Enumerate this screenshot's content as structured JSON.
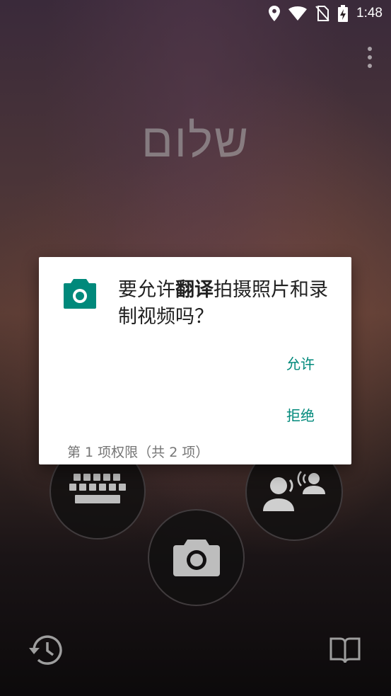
{
  "status_bar": {
    "time": "1:48",
    "icons": [
      "location-icon",
      "wifi-icon",
      "no-sim-icon",
      "battery-charging-icon"
    ]
  },
  "app": {
    "hero_word": "שלום",
    "menu_icon": "overflow-menu-icon",
    "buttons": [
      "keyboard-icon",
      "conversation-icon",
      "camera-icon"
    ],
    "bottom_icons": [
      "history-icon",
      "phrasebook-icon"
    ]
  },
  "dialog": {
    "title_prefix": "要允许",
    "title_app": "翻译",
    "title_suffix": "拍摄照片和录制视频吗？",
    "allow_label": "允许",
    "deny_label": "拒绝",
    "counter": "第 1 项权限（共 2 项）",
    "accent": "#00897b",
    "icon": "camera-icon"
  }
}
